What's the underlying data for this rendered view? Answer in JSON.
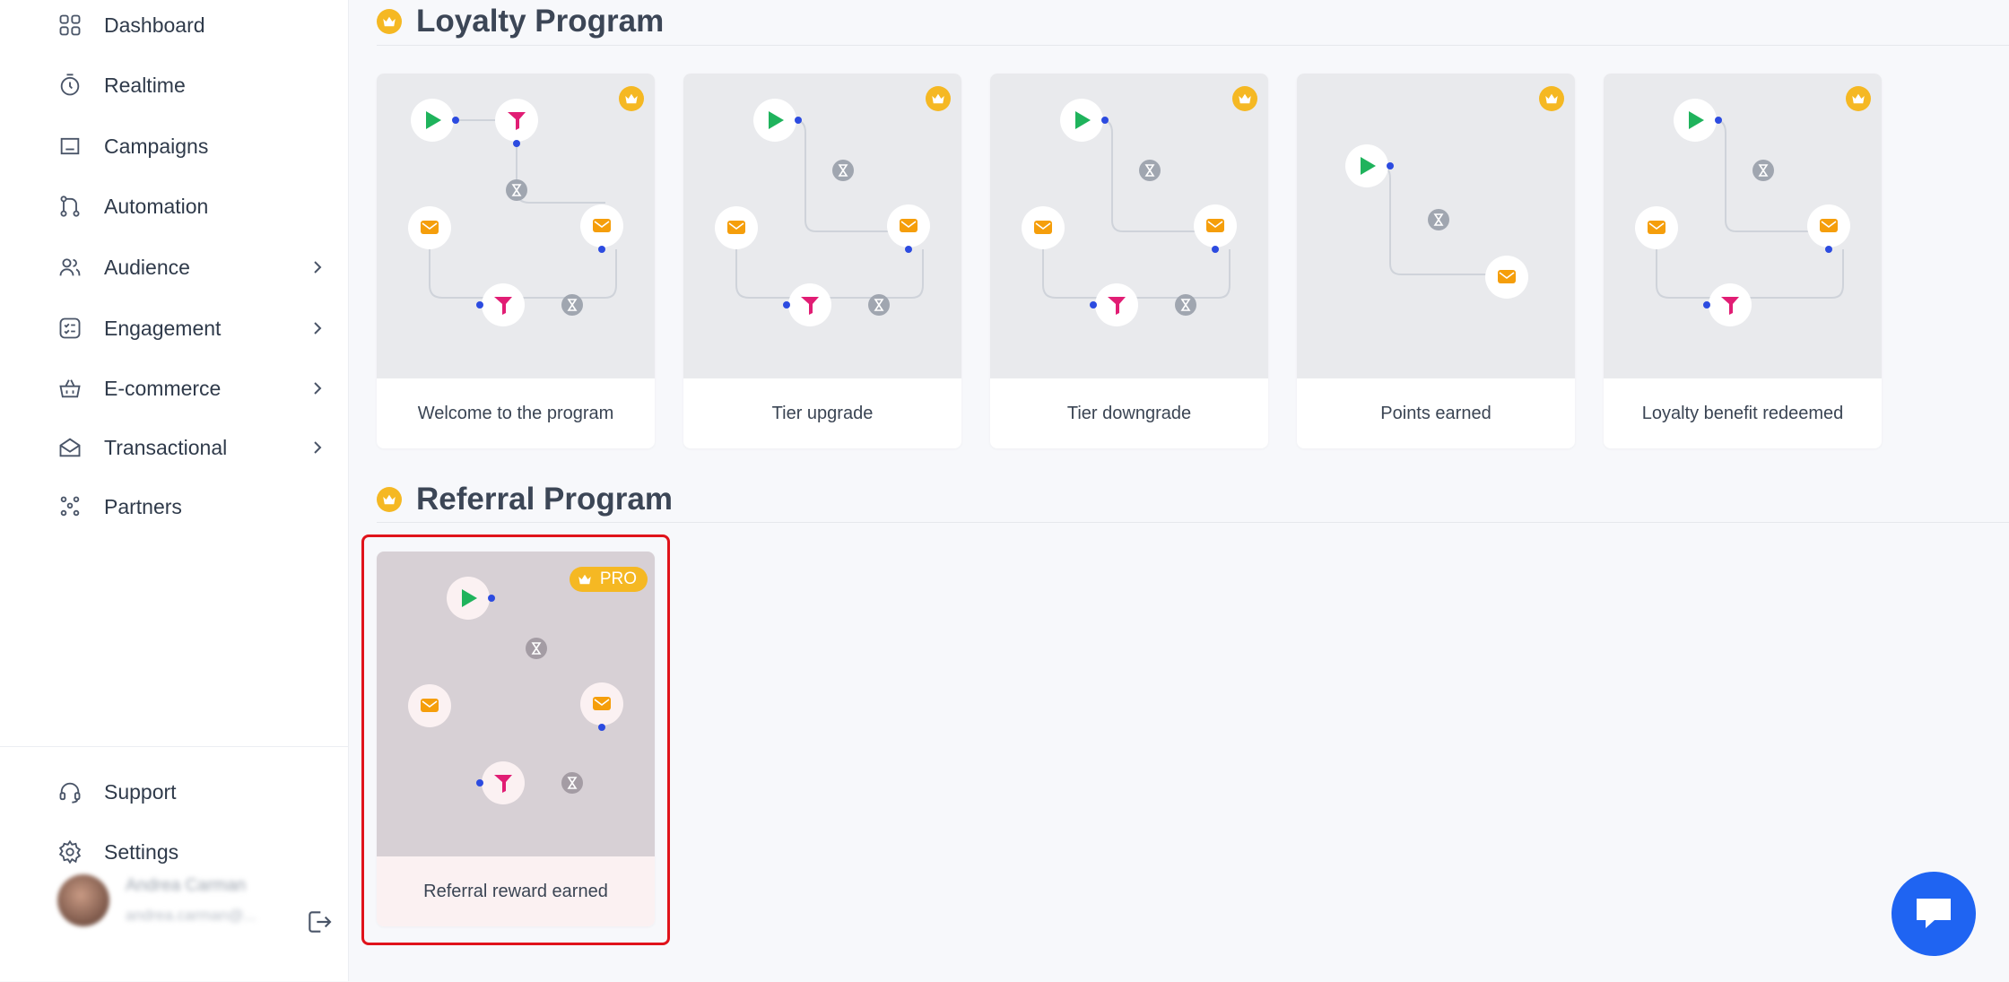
{
  "sidebar": {
    "items": [
      {
        "label": "Dashboard",
        "icon": "dashboard-grid-icon"
      },
      {
        "label": "Realtime",
        "icon": "stopwatch-icon"
      },
      {
        "label": "Campaigns",
        "icon": "folder-icon"
      },
      {
        "label": "Automation",
        "icon": "git-branch-icon"
      },
      {
        "label": "Audience",
        "icon": "users-icon",
        "has_submenu": true
      },
      {
        "label": "Engagement",
        "icon": "checklist-icon",
        "has_submenu": true
      },
      {
        "label": "E-commerce",
        "icon": "basket-icon",
        "has_submenu": true
      },
      {
        "label": "Transactional",
        "icon": "envelope-open-icon",
        "has_submenu": true
      },
      {
        "label": "Partners",
        "icon": "partners-icon"
      }
    ],
    "bottom": [
      {
        "label": "Support",
        "icon": "headset-icon"
      },
      {
        "label": "Settings",
        "icon": "gear-icon"
      }
    ],
    "user": {
      "name": "Andrea Carman",
      "email": "andrea.carman@..."
    }
  },
  "sections": {
    "loyalty": {
      "title": "Loyalty Program",
      "cards": [
        {
          "caption": "Welcome to the program"
        },
        {
          "caption": "Tier upgrade"
        },
        {
          "caption": "Tier downgrade"
        },
        {
          "caption": "Points earned"
        },
        {
          "caption": "Loyalty benefit redeemed"
        }
      ]
    },
    "referral": {
      "title": "Referral Program",
      "cards": [
        {
          "caption": "Referral reward earned",
          "badge": "PRO"
        }
      ]
    }
  },
  "colors": {
    "accent_gold": "#f5b823",
    "start_green": "#1fb35c",
    "email_orange": "#f59e0b",
    "split_magenta": "#e11d74",
    "connector_blue": "#2c4be0",
    "chat_blue": "#1f64f2",
    "highlight_red": "#e0131b"
  }
}
